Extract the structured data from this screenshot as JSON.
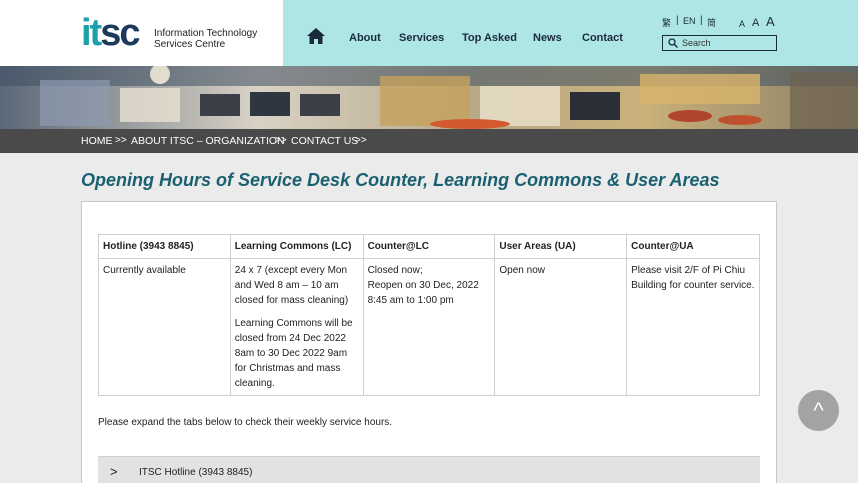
{
  "header": {
    "logo": {
      "mark_it": "it",
      "mark_sc": "sc",
      "line1": "Information Technology",
      "line2": "Services Centre"
    },
    "home_icon": "home-icon",
    "nav": [
      "About",
      "Services",
      "Top Asked",
      "News",
      "Contact"
    ],
    "languages": [
      "繁",
      "EN",
      "简"
    ],
    "separators": [
      "|",
      "|"
    ],
    "font_sizes": [
      "A",
      "A",
      "A"
    ],
    "search": {
      "placeholder": "Search",
      "icon": "search-icon"
    }
  },
  "breadcrumb": {
    "items": [
      "HOME",
      "ABOUT ITSC – ORGANIZATION",
      "CONTACT US"
    ],
    "separator": ">>"
  },
  "page_title": "Opening Hours of Service Desk Counter, Learning Commons & User Areas",
  "table": {
    "headers": [
      "Hotline (3943 8845)",
      "Learning Commons (LC)",
      "Counter@LC",
      "User Areas (UA)",
      "Counter@UA"
    ],
    "cells": {
      "hotline": "Currently available",
      "lc_p1": "24 x 7 (except every Mon and Wed 8 am – 10 am closed for mass cleaning)",
      "lc_p2": "Learning Commons will be closed from 24 Dec 2022 8am to 30 Dec 2022 9am for Christmas and mass cleaning.",
      "counter_lc_1": "Closed now;",
      "counter_lc_2": "Reopen on 30 Dec, 2022",
      "counter_lc_3": "8:45 am to 1:00 pm",
      "ua": "Open now",
      "counter_ua": "Please visit 2/F of Pi Chiu Building for counter service."
    }
  },
  "expand_note": "Please expand the tabs below to check their weekly service hours.",
  "accordion": {
    "chevron": ">",
    "first_title": "ITSC Hotline (3943 8845)"
  },
  "back_to_top": "^",
  "colors": {
    "nav_bg": "#aee6e6",
    "title": "#1b6070",
    "crumb_bg": "#4a4a4a",
    "logo_teal": "#1aa0a8",
    "logo_navy": "#1b3a5c"
  }
}
